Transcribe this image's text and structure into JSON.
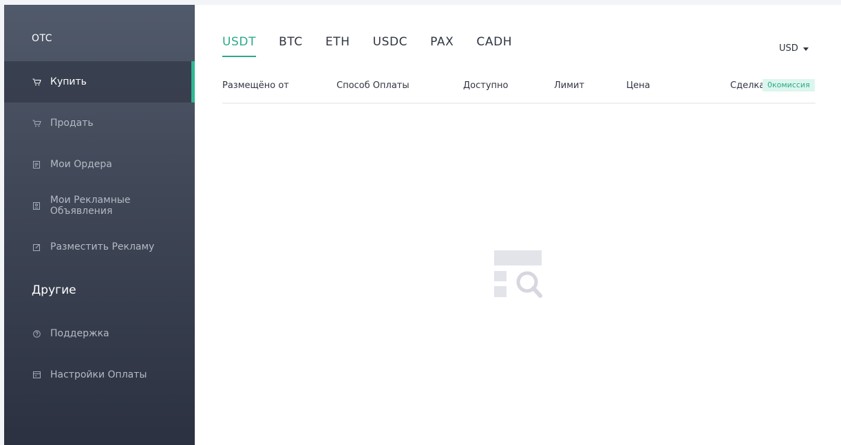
{
  "sidebar": {
    "otc_title": "OTC",
    "nav": [
      {
        "label": "Купить",
        "icon": "cart-icon",
        "active": true
      },
      {
        "label": "Продать",
        "icon": "cart-icon",
        "active": false
      },
      {
        "label": "Мои Ордера",
        "icon": "document-icon",
        "active": false
      },
      {
        "label": "Мои Рекламные Объявления",
        "icon": "ad-icon",
        "active": false
      },
      {
        "label": "Разместить Рекламу",
        "icon": "edit-icon",
        "active": false
      }
    ],
    "other_title": "Другие",
    "other_nav": [
      {
        "label": "Поддержка",
        "icon": "help-circle-icon"
      },
      {
        "label": "Настройки Оплаты",
        "icon": "card-icon"
      }
    ]
  },
  "main": {
    "tabs": [
      {
        "label": "USDT",
        "active": true
      },
      {
        "label": "BTC"
      },
      {
        "label": "ETH"
      },
      {
        "label": "USDC"
      },
      {
        "label": "PAX"
      },
      {
        "label": "CADH"
      }
    ],
    "currency_select": "USD",
    "table_headers": {
      "placed_by": "Размещёно от",
      "payment_method": "Способ Оплаты",
      "available": "Доступно",
      "limit": "Лимит",
      "price": "Цена",
      "trade": "Сделка"
    },
    "fee_badge": "0комиссия",
    "empty_state_icon": "empty-search-icon"
  },
  "colors": {
    "accent": "#2aa98a",
    "sidebar_top": "#515a6b",
    "sidebar_bottom": "#2b3140",
    "badge_bg": "#dcf6ed"
  }
}
